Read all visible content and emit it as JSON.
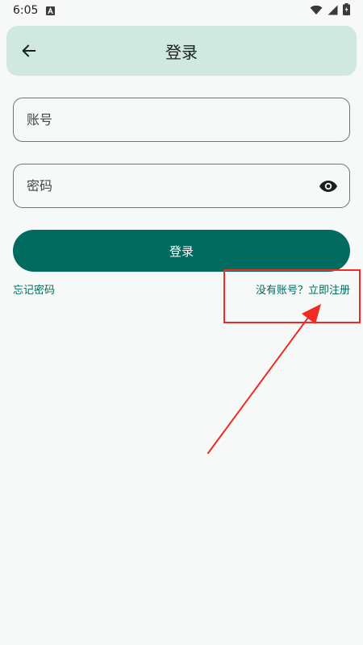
{
  "status_bar": {
    "time": "6:05",
    "notification_icon": "a-icon",
    "wifi_icon": "wifi-icon",
    "signal_icon": "signal-icon",
    "battery_icon": "battery-icon"
  },
  "app_bar": {
    "title": "登录",
    "back_icon": "arrow-left-icon",
    "background": "#cfe8e0"
  },
  "form": {
    "username_placeholder": "账号",
    "password_placeholder": "密码",
    "password_visibility_icon": "eye-icon",
    "login_label": "登录"
  },
  "links": {
    "forgot_password": "忘记密码",
    "register": "没有账号？立即注册"
  },
  "colors": {
    "primary": "#006b5e",
    "annotation": "#f02b24"
  }
}
